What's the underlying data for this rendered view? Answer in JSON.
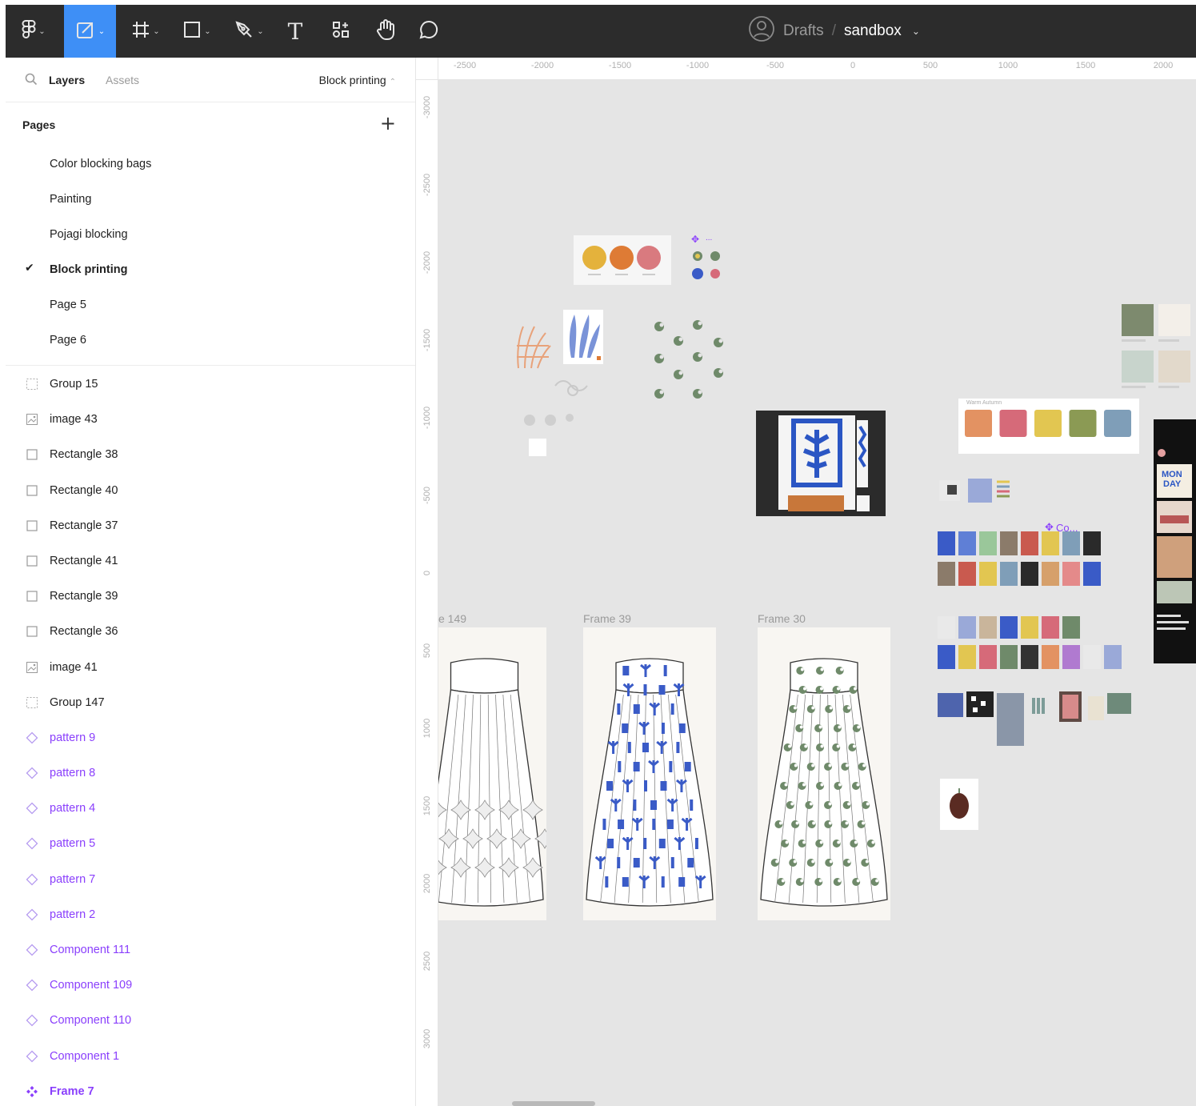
{
  "toolbar": {
    "tools": [
      {
        "name": "main-menu",
        "icon": "figma-logo-icon"
      },
      {
        "name": "move-tool",
        "icon": "move-icon",
        "active": true
      },
      {
        "name": "frame-tool",
        "icon": "frame-icon"
      },
      {
        "name": "shape-tool",
        "icon": "rectangle-icon"
      },
      {
        "name": "pen-tool",
        "icon": "pen-icon"
      },
      {
        "name": "text-tool",
        "icon": "text-icon"
      },
      {
        "name": "resources-tool",
        "icon": "resources-icon"
      },
      {
        "name": "hand-tool",
        "icon": "hand-icon"
      },
      {
        "name": "comment-tool",
        "icon": "comment-icon"
      }
    ],
    "text_tool_glyph": "T",
    "breadcrumb": {
      "drafts": "Drafts",
      "separator": "/",
      "file": "sandbox"
    }
  },
  "left_panel": {
    "tabs": {
      "layers": "Layers",
      "assets": "Assets"
    },
    "current_page": "Block printing",
    "pages_title": "Pages",
    "add_page_glyph": "+",
    "checkmark": "✔",
    "pages": [
      "Color blocking bags",
      "Painting",
      "Pojagi blocking",
      "Block printing",
      "Page 5",
      "Page 6"
    ],
    "active_page": "Block printing",
    "layers": [
      {
        "label": "Group 15",
        "type": "group"
      },
      {
        "label": "image 43",
        "type": "image"
      },
      {
        "label": "Rectangle 38",
        "type": "rect"
      },
      {
        "label": "Rectangle 40",
        "type": "rect"
      },
      {
        "label": "Rectangle 37",
        "type": "rect"
      },
      {
        "label": "Rectangle 41",
        "type": "rect"
      },
      {
        "label": "Rectangle 39",
        "type": "rect"
      },
      {
        "label": "Rectangle 36",
        "type": "rect"
      },
      {
        "label": "image 41",
        "type": "image"
      },
      {
        "label": "Group 147",
        "type": "group"
      },
      {
        "label": "pattern 9",
        "type": "component"
      },
      {
        "label": "pattern 8",
        "type": "component"
      },
      {
        "label": "pattern 4",
        "type": "component"
      },
      {
        "label": "pattern 5",
        "type": "component"
      },
      {
        "label": "pattern 7",
        "type": "component"
      },
      {
        "label": "pattern 2",
        "type": "component"
      },
      {
        "label": "Component 111",
        "type": "component"
      },
      {
        "label": "Component 109",
        "type": "component"
      },
      {
        "label": "Component 110",
        "type": "component"
      },
      {
        "label": "Component 1",
        "type": "component"
      },
      {
        "label": "Frame 7",
        "type": "main-component"
      }
    ]
  },
  "ruler": {
    "x_ticks": [
      "-2500",
      "-2000",
      "-1500",
      "-1000",
      "-500",
      "0",
      "500",
      "1000",
      "1500",
      "2000"
    ],
    "y_ticks": [
      "-3000",
      "-2500",
      "-2000",
      "-1500",
      "-1000",
      "-500",
      "0",
      "500",
      "1000",
      "1500",
      "2000",
      "2500",
      "3000"
    ]
  },
  "canvas": {
    "frame_labels": [
      "e 149",
      "Frame 39",
      "Frame 30"
    ],
    "component_labels": [
      "...",
      "Co..."
    ],
    "palette_small": [
      "#e4b23c",
      "#de7b35",
      "#d97a7f"
    ],
    "palette_large_title": "Warm Autumn",
    "palette_large": [
      "#e39262",
      "#d66a79",
      "#e2c651",
      "#8b9a54",
      "#7f9eb8"
    ],
    "phone_text": "MON DAY",
    "colors": {
      "accent": "#3e8ff6",
      "component": "#8a3ffc",
      "blue_print": "#3a5bc7",
      "green_print": "#6f8a6a"
    }
  }
}
